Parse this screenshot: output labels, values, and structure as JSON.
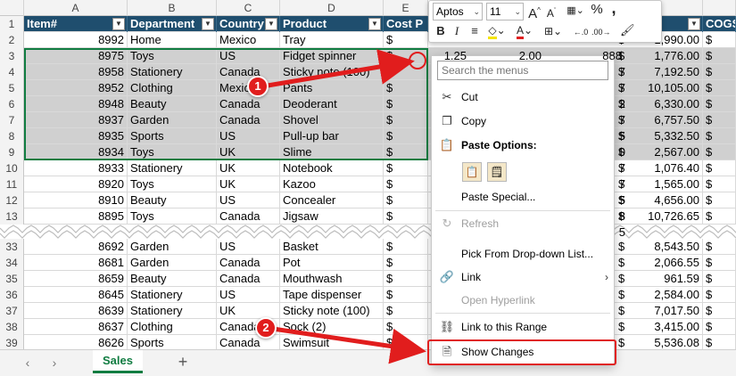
{
  "columns": {
    "letters": [
      "A",
      "B",
      "C",
      "D",
      "E",
      "H",
      ""
    ],
    "headers": [
      "Item#",
      "Department",
      "Country",
      "Product",
      "Cost P",
      "",
      "COGS"
    ]
  },
  "rows_top": [
    {
      "n": "2",
      "item": "8992",
      "dept": "Home",
      "country": "Mexico",
      "product": "Tray",
      "cur": "$",
      "h_cur": "$",
      "h_val": "1,990.00",
      "g": "$",
      "sel": false
    },
    {
      "n": "3",
      "item": "8975",
      "dept": "Toys",
      "country": "US",
      "product": "Fidget spinner",
      "cur": "$",
      "h_cur": "$",
      "h_val": "1,776.00",
      "g": "$",
      "sel": true
    },
    {
      "n": "4",
      "item": "8958",
      "dept": "Stationery",
      "country": "Canada",
      "product": "Sticky note (100)",
      "cur": "$",
      "h_cur": "$",
      "h_val": "7,192.50",
      "g": "$",
      "sel": true
    },
    {
      "n": "5",
      "item": "8952",
      "dept": "Clothing",
      "country": "Mexico",
      "product": "Pants",
      "cur": "$",
      "h_cur": "$",
      "h_val": "10,105.00",
      "g": "$",
      "sel": true
    },
    {
      "n": "6",
      "item": "8948",
      "dept": "Beauty",
      "country": "Canada",
      "product": "Deoderant",
      "cur": "$",
      "h_cur": "$",
      "h_val": "6,330.00",
      "g": "$",
      "sel": true
    },
    {
      "n": "7",
      "item": "8937",
      "dept": "Garden",
      "country": "Canada",
      "product": "Shovel",
      "cur": "$",
      "h_cur": "$",
      "h_val": "6,757.50",
      "g": "$",
      "sel": true
    },
    {
      "n": "8",
      "item": "8935",
      "dept": "Sports",
      "country": "US",
      "product": "Pull-up bar",
      "cur": "$",
      "h_cur": "$",
      "h_val": "5,332.50",
      "g": "$",
      "sel": true
    },
    {
      "n": "9",
      "item": "8934",
      "dept": "Toys",
      "country": "UK",
      "product": "Slime",
      "cur": "$",
      "h_cur": "$",
      "h_val": "2,567.00",
      "g": "$",
      "sel": true
    },
    {
      "n": "10",
      "item": "8933",
      "dept": "Stationery",
      "country": "UK",
      "product": "Notebook",
      "cur": "$",
      "h_cur": "$",
      "h_val": "1,076.40",
      "g": "$",
      "sel": false
    },
    {
      "n": "11",
      "item": "8920",
      "dept": "Toys",
      "country": "UK",
      "product": "Kazoo",
      "cur": "$",
      "h_cur": "$",
      "h_val": "1,565.00",
      "g": "$",
      "sel": false
    },
    {
      "n": "12",
      "item": "8910",
      "dept": "Beauty",
      "country": "US",
      "product": "Concealer",
      "cur": "$",
      "h_cur": "$",
      "h_val": "4,656.00",
      "g": "$",
      "sel": false
    },
    {
      "n": "13",
      "item": "8895",
      "dept": "Toys",
      "country": "Canada",
      "product": "Jigsaw",
      "cur": "$",
      "h_cur": "$",
      "h_val": "10,726.65",
      "g": "$",
      "sel": false
    }
  ],
  "rows_bottom": [
    {
      "n": "33",
      "item": "8692",
      "dept": "Garden",
      "country": "US",
      "product": "Basket",
      "cur": "$",
      "h_cur": "$",
      "h_val": "8,543.50",
      "g": "$"
    },
    {
      "n": "34",
      "item": "8681",
      "dept": "Garden",
      "country": "Canada",
      "product": "Pot",
      "cur": "$",
      "h_cur": "$",
      "h_val": "2,066.55",
      "g": "$"
    },
    {
      "n": "35",
      "item": "8659",
      "dept": "Beauty",
      "country": "Canada",
      "product": "Mouthwash",
      "cur": "$",
      "h_cur": "$",
      "h_val": "961.59",
      "g": "$"
    },
    {
      "n": "36",
      "item": "8645",
      "dept": "Stationery",
      "country": "US",
      "product": "Tape dispenser",
      "cur": "$",
      "h_cur": "$",
      "h_val": "2,584.00",
      "g": "$"
    },
    {
      "n": "37",
      "item": "8639",
      "dept": "Stationery",
      "country": "UK",
      "product": "Sticky note (100)",
      "cur": "$",
      "h_cur": "$",
      "h_val": "7,017.50",
      "g": "$"
    },
    {
      "n": "38",
      "item": "8637",
      "dept": "Clothing",
      "country": "Canada",
      "product": "Sock (2)",
      "cur": "$",
      "h_cur": "$",
      "h_val": "3,415.00",
      "g": "$"
    },
    {
      "n": "39",
      "item": "8626",
      "dept": "Sports",
      "country": "Canada",
      "product": "Swimsuit",
      "cur": "$",
      "h_cur": "$",
      "h_val": "5,536.08",
      "g": "$"
    }
  ],
  "partial_cells": {
    "row3_e_val": "1.25",
    "row3_f_val": "2.00",
    "row3_g_val": "888"
  },
  "menu_edge_digits": [
    "7",
    "7",
    "2",
    "7",
    "5",
    "0",
    "7",
    "7",
    "5",
    "8",
    "5"
  ],
  "mini_toolbar": {
    "font_name": "Aptos",
    "font_size": "11",
    "icons": [
      "grow-font",
      "shrink-font",
      "accounting-format",
      "percent",
      "comma-style",
      "bold",
      "italic",
      "align-center",
      "fill-color",
      "font-color",
      "borders",
      "increase-decimal",
      "decrease-decimal",
      "format-painter"
    ]
  },
  "context_menu": {
    "search_placeholder": "Search the menus",
    "cut": "Cut",
    "copy": "Copy",
    "paste_options": "Paste Options:",
    "paste_special": "Paste Special...",
    "refresh": "Refresh",
    "pick_from_list": "Pick From Drop-down List...",
    "link": "Link",
    "open_hyperlink": "Open Hyperlink",
    "link_to_range": "Link to this Range",
    "show_changes": "Show Changes"
  },
  "sheet_tabs": {
    "active": "Sales",
    "add": "+"
  },
  "annotations": {
    "badge1": "1",
    "badge2": "2"
  },
  "colors": {
    "header_bg": "#1f4e6e",
    "selection": "#d0d0d0",
    "accent_green": "#107c41",
    "annotation_red": "#e11d1d"
  }
}
